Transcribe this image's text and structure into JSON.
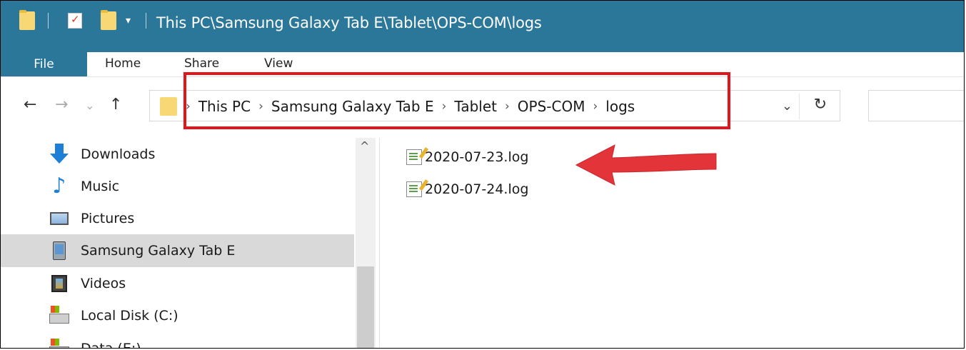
{
  "window": {
    "title": "This PC\\Samsung Galaxy Tab E\\Tablet\\OPS-COM\\logs",
    "quick_access_dropdown": "▾"
  },
  "ribbon": {
    "tabs": [
      "File",
      "Home",
      "Share",
      "View"
    ]
  },
  "navigation": {
    "back": "←",
    "forward": "→",
    "recent": "⌄",
    "up": "↑",
    "refresh": "↻",
    "address_dropdown": "⌄"
  },
  "address": {
    "separator": "›",
    "crumbs": [
      "This PC",
      "Samsung Galaxy Tab E",
      "Tablet",
      "OPS-COM",
      "logs"
    ]
  },
  "nav_pane": {
    "scroll_up": "^",
    "items": [
      {
        "label": "Downloads",
        "icon": "downloads-icon"
      },
      {
        "label": "Music",
        "icon": "music-icon"
      },
      {
        "label": "Pictures",
        "icon": "pictures-icon"
      },
      {
        "label": "Samsung Galaxy Tab E",
        "icon": "device-icon",
        "selected": true
      },
      {
        "label": "Videos",
        "icon": "videos-icon"
      },
      {
        "label": "Local Disk (C:)",
        "icon": "local-disk-icon"
      },
      {
        "label": "Data (E:)",
        "icon": "drive-icon"
      }
    ]
  },
  "files": [
    {
      "name": "2020-07-23.log",
      "icon": "log-file-icon"
    },
    {
      "name": "2020-07-24.log",
      "icon": "log-file-icon"
    }
  ],
  "annotation": {
    "highlight_color": "#e3141b",
    "arrow_color": "#e3343a"
  },
  "colors": {
    "titlebar": "#2b7799",
    "selected_nav": "#d9d9d9"
  }
}
